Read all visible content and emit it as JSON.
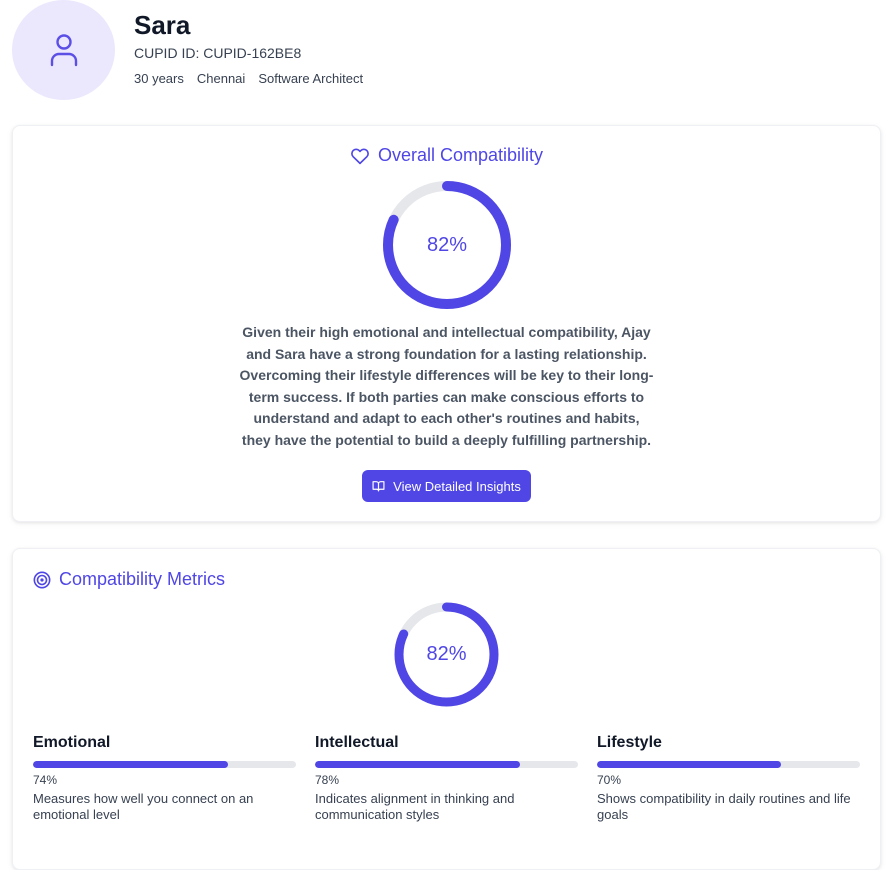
{
  "profile": {
    "name": "Sara",
    "cupid_id": "CUPID ID: CUPID-162BE8",
    "meta": [
      "30 years",
      "Chennai",
      "Software Architect"
    ],
    "avatar_icon": "user-icon"
  },
  "overall": {
    "title": "Overall Compatibility",
    "icon": "heart-icon",
    "score_label": "82%",
    "score": 82,
    "summary": "Given their high emotional and intellectual compatibility, Ajay and Sara have a strong foundation for a lasting relationship. Overcoming their lifestyle differences will be key to their long-term success. If both parties can make conscious efforts to understand and adapt to each other's routines and habits, they have the potential to build a deeply fulfilling partnership.",
    "button_label": "View Detailed Insights",
    "button_icon": "book-open-icon"
  },
  "metrics": {
    "title": "Compatibility Metrics",
    "icon": "target-icon",
    "score_label": "82%",
    "score": 82,
    "items": [
      {
        "name": "Emotional",
        "value": 74,
        "value_label": "74%",
        "description": "Measures how well you connect on an emotional level"
      },
      {
        "name": "Intellectual",
        "value": 78,
        "value_label": "78%",
        "description": "Indicates alignment in thinking and communication styles"
      },
      {
        "name": "Lifestyle",
        "value": 70,
        "value_label": "70%",
        "description": "Shows compatibility in daily routines and life goals"
      }
    ]
  },
  "colors": {
    "accent": "#4f46e5",
    "track": "#e5e7eb",
    "avatar_bg": "#ebe7fd"
  }
}
